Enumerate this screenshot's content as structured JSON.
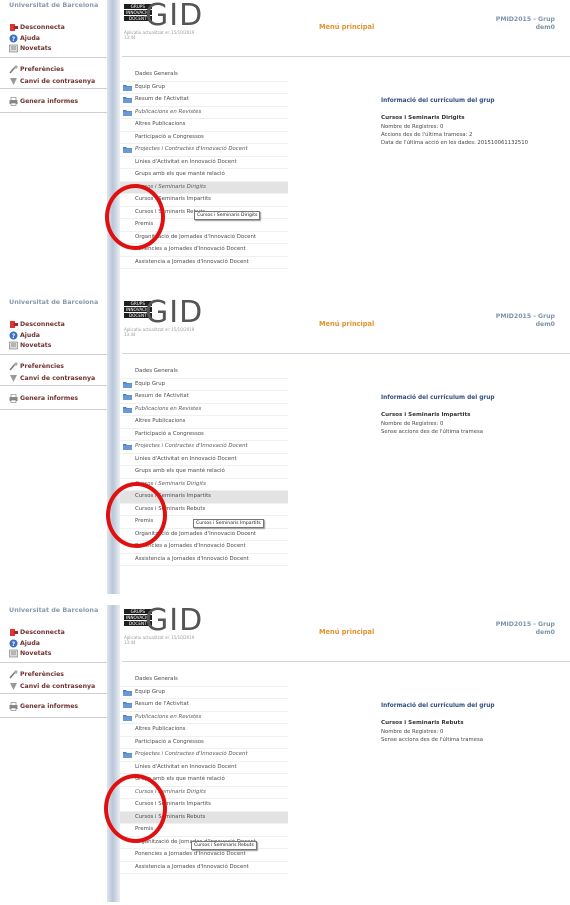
{
  "sidebar": {
    "university": "Universitat de Barcelona",
    "items": [
      {
        "label": "Desconnecta",
        "icon": "logout-icon"
      },
      {
        "label": "Ajuda",
        "icon": "help-icon"
      },
      {
        "label": "Novetats",
        "icon": "news-icon"
      },
      {
        "label": "Preferències",
        "icon": "preferences-icon"
      },
      {
        "label": "Canvi de contrasenya",
        "icon": "password-icon"
      },
      {
        "label": "Genera informes",
        "icon": "printer-icon"
      }
    ]
  },
  "header": {
    "logo_lines": [
      "GRUPS",
      "INNOVACIÓ",
      "DOCENT"
    ],
    "logo_big": "GID",
    "updated": "Aplicatiu actualitzat el: 15/10/2019 13:44",
    "menu_title": "Menú principal",
    "project": "PMID2015 - Grup",
    "user": "dem0"
  },
  "menu": [
    {
      "label": "Dades Generals",
      "folder": false,
      "italic": false
    },
    {
      "label": "Equip Grup",
      "folder": true,
      "italic": false
    },
    {
      "label": "Resum de l'Activitat",
      "folder": true,
      "italic": false
    },
    {
      "label": "Publicacions en Revistes",
      "folder": true,
      "italic": true
    },
    {
      "label": "Altres Publicacions",
      "folder": false,
      "italic": false
    },
    {
      "label": "Participació a Congressos",
      "folder": false,
      "italic": false
    },
    {
      "label": "Projectes i Contractes d'Innovació Docent",
      "folder": true,
      "italic": true
    },
    {
      "label": "Línies d'Activitat en Innovació Docent",
      "folder": false,
      "italic": false
    },
    {
      "label": "Grups amb els que manté relació",
      "folder": false,
      "italic": false
    },
    {
      "label": "Cursos i Seminaris Dirigits",
      "folder": false,
      "italic": true
    },
    {
      "label": "Cursos i Seminaris Impartits",
      "folder": false,
      "italic": false
    },
    {
      "label": "Cursos i Seminaris Rebuts",
      "folder": false,
      "italic": false
    },
    {
      "label": "Premis",
      "folder": false,
      "italic": false
    },
    {
      "label": "Organització de Jornades d'Innovació Docent",
      "folder": false,
      "italic": false
    },
    {
      "label": "Ponencies a Jornades d'Innovació Docent",
      "folder": false,
      "italic": false
    },
    {
      "label": "Assistencia a Jornades d'Innovació Docent",
      "folder": false,
      "italic": false
    }
  ],
  "panels": [
    {
      "selected_index": 9,
      "tooltip": "Cursos i Seminaris Dirigits",
      "info_title": "Informació del currículum del grup",
      "info_subtitle": "Cursos i Seminaris Dirigits",
      "info_lines": [
        "Nombre de Registres: 0",
        "Accions des de l'última tramesa: 2",
        "Data de l'última acció en les dades: 20151006113251­0"
      ]
    },
    {
      "selected_index": 10,
      "tooltip": "Cursos i Seminaris Impartits",
      "info_title": "Informació del currículum del grup",
      "info_subtitle": "Cursos i Seminaris Impartits",
      "info_lines": [
        "Nombre de Registres: 0",
        "Sense accions des de l'última tramesa"
      ]
    },
    {
      "selected_index": 11,
      "tooltip": "Cursos i Seminaris Rebuts",
      "info_title": "Informació del currículum del grup",
      "info_subtitle": "Cursos i Seminaris Rebuts",
      "info_lines": [
        "Nombre de Registres: 0",
        "Sense accions des de l'última tramesa"
      ]
    }
  ],
  "colors": {
    "menu_title": "#e2922e",
    "sidebar_text": "#6e3330",
    "info_title": "#2f4d7a",
    "annotation": "#e01010"
  }
}
